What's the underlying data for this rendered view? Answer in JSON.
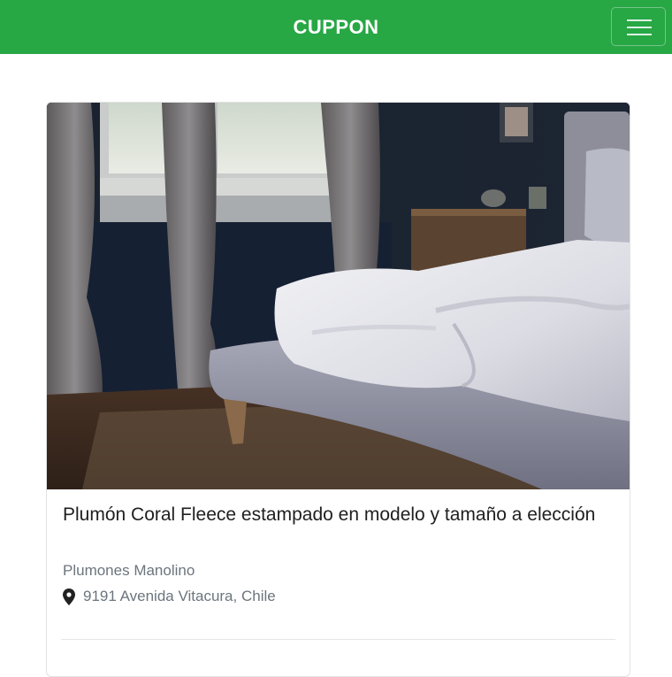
{
  "navbar": {
    "brand": "CUPPON",
    "toggle_icon": "hamburger-menu-icon",
    "background": "#28a745"
  },
  "deal": {
    "image_alt": "Bedroom with bed and white duvet",
    "title": "Plumón Coral Fleece estampado en modelo y tamaño a elección",
    "merchant": "Plumones Manolino",
    "location_icon": "map-marker-icon",
    "location": "9191 Avenida Vitacura, Chile"
  }
}
